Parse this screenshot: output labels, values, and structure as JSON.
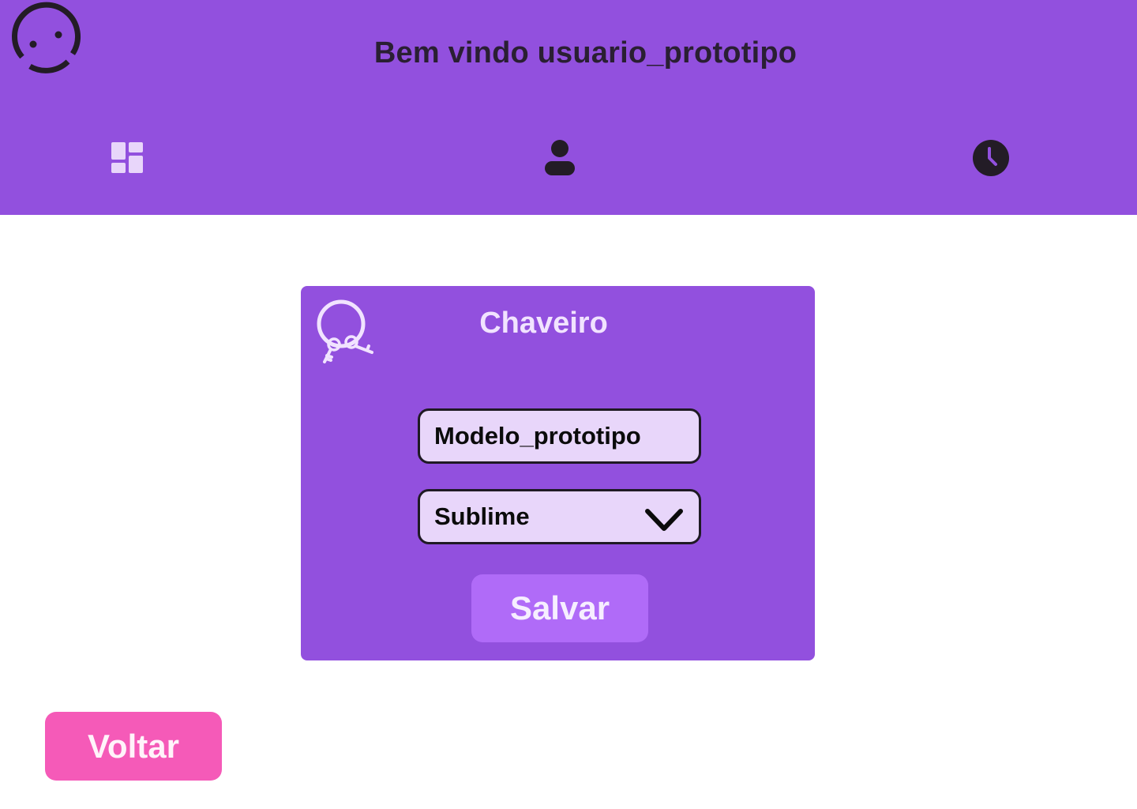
{
  "header": {
    "welcome_text": "Bem vindo usuario_prototipo",
    "logo_icon": "smiley-ring-icon",
    "background_color": "#9250DE",
    "nav": [
      {
        "name": "dashboard",
        "icon": "dashboard-icon",
        "active": true
      },
      {
        "name": "profile",
        "icon": "person-icon",
        "active": false
      },
      {
        "name": "history",
        "icon": "clock-icon",
        "active": false
      }
    ]
  },
  "card": {
    "title": "Chaveiro",
    "icon": "keyring-icon",
    "model_field": {
      "value": "Modelo_prototipo"
    },
    "select": {
      "selected": "Sublime"
    },
    "save_label": "Salvar"
  },
  "footer": {
    "back_label": "Voltar"
  },
  "colors": {
    "primary": "#9250DE",
    "save_button": "#B06BF8",
    "back_button": "#F55AB8",
    "field_bg": "#E8D6FA",
    "dark": "#2A1F33"
  }
}
